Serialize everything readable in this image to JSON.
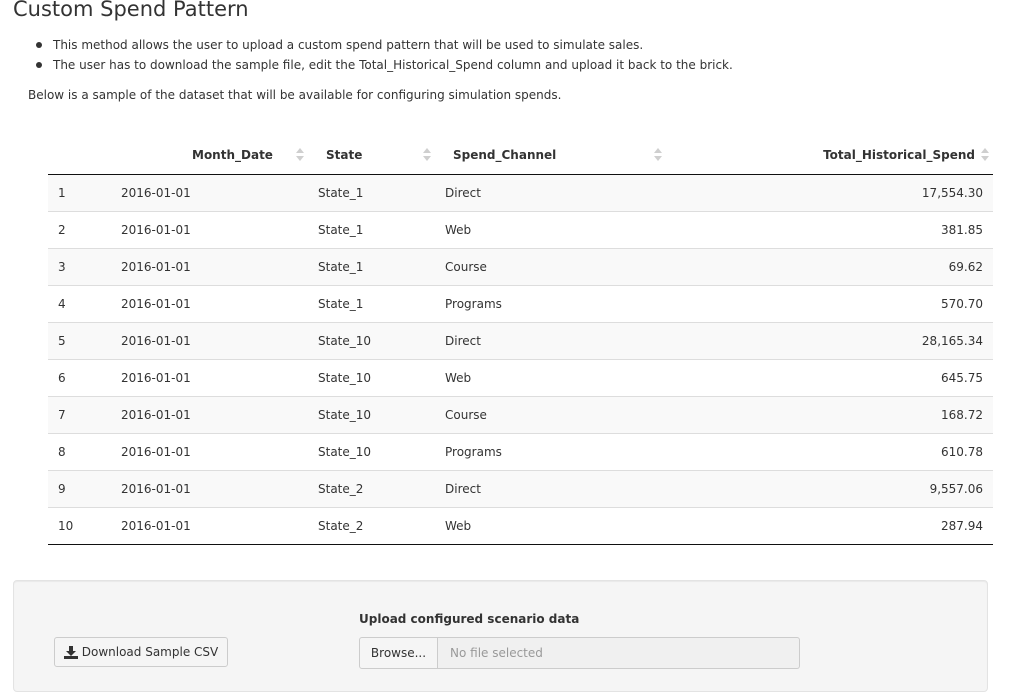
{
  "page": {
    "title": "Custom Spend Pattern",
    "bullets": [
      "This method allows the user to upload a custom spend pattern that will be used to simulate sales.",
      "The user has to download the sample file, edit the Total_Historical_Spend column and upload it back to the brick."
    ],
    "intro": "Below is a sample of the dataset that will be available for configuring simulation spends."
  },
  "table": {
    "columns": [
      "",
      "Month_Date",
      "State",
      "Spend_Channel",
      "Total_Historical_Spend"
    ],
    "rows": [
      [
        "1",
        "2016-01-01",
        "State_1",
        "Direct",
        "17,554.30"
      ],
      [
        "2",
        "2016-01-01",
        "State_1",
        "Web",
        "381.85"
      ],
      [
        "3",
        "2016-01-01",
        "State_1",
        "Course",
        "69.62"
      ],
      [
        "4",
        "2016-01-01",
        "State_1",
        "Programs",
        "570.70"
      ],
      [
        "5",
        "2016-01-01",
        "State_10",
        "Direct",
        "28,165.34"
      ],
      [
        "6",
        "2016-01-01",
        "State_10",
        "Web",
        "645.75"
      ],
      [
        "7",
        "2016-01-01",
        "State_10",
        "Course",
        "168.72"
      ],
      [
        "8",
        "2016-01-01",
        "State_10",
        "Programs",
        "610.78"
      ],
      [
        "9",
        "2016-01-01",
        "State_2",
        "Direct",
        "9,557.06"
      ],
      [
        "10",
        "2016-01-01",
        "State_2",
        "Web",
        "287.94"
      ]
    ]
  },
  "panel": {
    "download_label": "Download Sample CSV",
    "download_icon": "download-icon",
    "upload_label": "Upload configured scenario data",
    "browse_label": "Browse...",
    "file_placeholder": "No file selected"
  }
}
